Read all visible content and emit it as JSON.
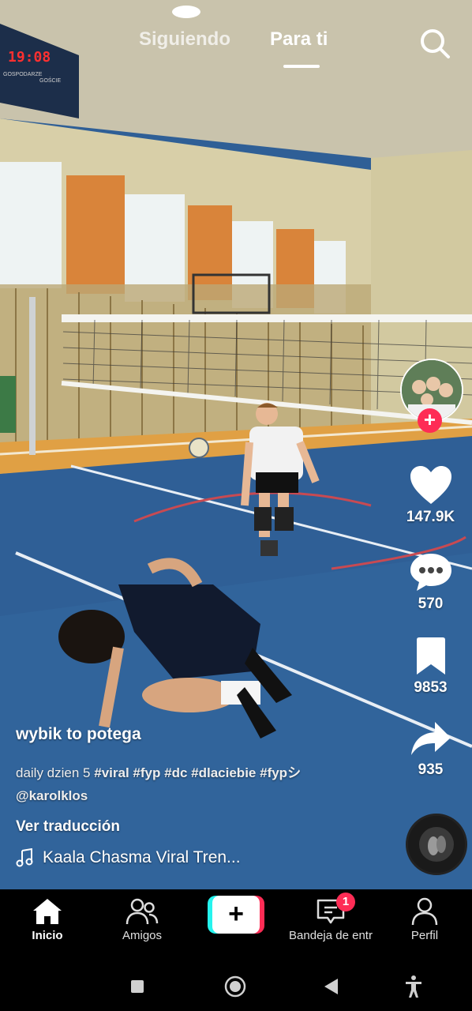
{
  "top_nav": {
    "following_label": "Siguiendo",
    "for_you_label": "Para ti",
    "active_tab": "Para ti",
    "search_icon": "search-icon"
  },
  "scene": {
    "scoreboard_time": "19:08",
    "scoreboard_home": "GOSPODARZE",
    "scoreboard_away": "GOŚCIE"
  },
  "actions": {
    "likes": "147.9K",
    "comments": "570",
    "saves": "9853",
    "shares": "935"
  },
  "caption": {
    "author": "wybik to potega",
    "description_text": "daily dzien 5",
    "hashtags": [
      "#viral",
      "#fyp",
      "#dc",
      "#dlaciebie",
      "#fypシ"
    ],
    "mention": "@karolklos",
    "translate_label": "Ver traducción",
    "music_title": "Kaala Chasma Viral Tren..."
  },
  "bottom_nav": {
    "home_label": "Inicio",
    "friends_label": "Amigos",
    "inbox_label": "Bandeja de entr",
    "profile_label": "Perfil",
    "inbox_badge": "1",
    "create_symbol": "+"
  },
  "colors": {
    "accent_red": "#fe2c55",
    "accent_cyan": "#25f4ee",
    "court_blue": "#2f5f96",
    "wall_orange": "#d9843a"
  }
}
